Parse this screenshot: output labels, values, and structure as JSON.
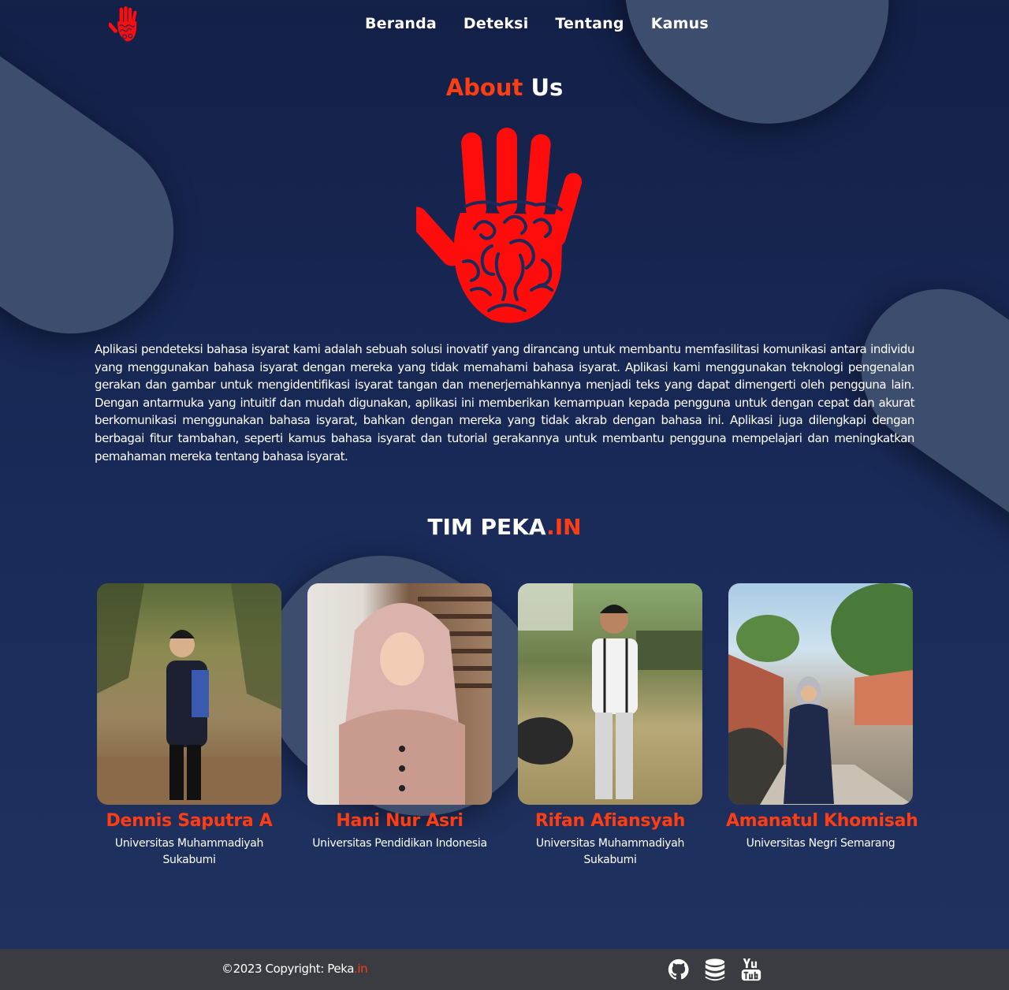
{
  "nav": {
    "logo": "hand-logo-icon",
    "links": [
      "Beranda",
      "Deteksi",
      "Tentang",
      "Kamus"
    ]
  },
  "about": {
    "title_accent": "About",
    "title_rest": "Us",
    "image": "hand-logo-icon",
    "description": "Aplikasi pendeteksi bahasa isyarat kami adalah sebuah solusi inovatif yang dirancang untuk membantu memfasilitasi komunikasi antara individu yang menggunakan bahasa isyarat dengan mereka yang tidak memahami bahasa isyarat. Aplikasi kami menggunakan teknologi pengenalan gerakan dan gambar untuk mengidentifikasi isyarat tangan dan menerjemahkannya menjadi teks yang dapat dimengerti oleh pengguna lain. Dengan antarmuka yang intuitif dan mudah digunakan, aplikasi ini memberikan kemampuan kepada pengguna untuk dengan cepat dan akurat berkomunikasi menggunakan bahasa isyarat, bahkan dengan mereka yang tidak akrab dengan bahasa ini. Aplikasi juga dilengkapi dengan berbagai fitur tambahan, seperti kamus bahasa isyarat dan tutorial gerakannya untuk membantu pengguna mempelajari dan meningkatkan pemahaman mereka tentang bahasa isyarat."
  },
  "team": {
    "title_main": "TIM PEKA",
    "title_accent": ".IN",
    "members": [
      {
        "name": "Dennis Saputra A",
        "university": "Universitas Muhammadiyah Sukabumi"
      },
      {
        "name": "Hani Nur Asri",
        "university": "Universitas Pendidikan Indonesia"
      },
      {
        "name": "Rifan Afiansyah",
        "university": "Universitas Muhammadiyah Sukabumi"
      },
      {
        "name": "Amanatul Khomisah",
        "university": "Universitas Negri Semarang"
      }
    ]
  },
  "footer": {
    "copyright_main": "©2023 Copyright: Peka",
    "copyright_accent": ".in",
    "icons": [
      "github-icon",
      "database-icon",
      "youtube-icon"
    ]
  },
  "colors": {
    "accent": "#ff3d12",
    "background": "#1a2b5a",
    "footer": "#3a3c41",
    "hand": "#ff0d0d"
  }
}
